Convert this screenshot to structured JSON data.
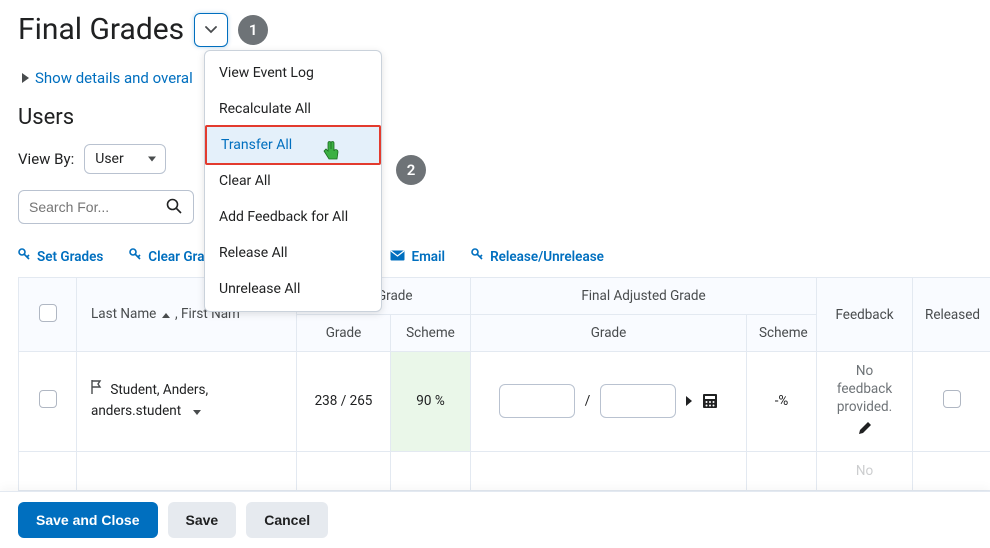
{
  "header": {
    "title": "Final Grades"
  },
  "steps": {
    "one": "1",
    "two": "2"
  },
  "links": {
    "show_details": "Show details and overal"
  },
  "users": {
    "heading": "Users",
    "view_by_label": "View By:",
    "view_by_value": "User",
    "search_placeholder": "Search For..."
  },
  "actions": {
    "set_grades": "Set Grades",
    "clear_grades": "Clear Gra",
    "email": "Email",
    "release": "Release/Unrelease"
  },
  "dropdown": {
    "view_event_log": "View Event Log",
    "recalculate_all": "Recalculate All",
    "transfer_all": "Transfer All",
    "clear_all": "Clear All",
    "add_feedback_all": "Add Feedback for All",
    "release_all": "Release All",
    "unrelease_all": "Unrelease All"
  },
  "table": {
    "headers": {
      "name": "Last Name ",
      "name2": " , First Nam",
      "calculated_grade": "ted Grade",
      "grade": "Grade",
      "scheme": "Scheme",
      "final_adjusted": "Final Adjusted Grade",
      "feedback": "Feedback",
      "released": "Released"
    },
    "rows": [
      {
        "name_line1": "Student, Anders,",
        "name_line2": "anders.student",
        "calc_grade": "238 / 265",
        "calc_scheme": "90 %",
        "adj_scheme": "-%",
        "feedback": "No feedback provided."
      }
    ]
  },
  "footer": {
    "save_close": "Save and Close",
    "save": "Save",
    "cancel": "Cancel"
  },
  "fragments": {
    "no": "No"
  }
}
